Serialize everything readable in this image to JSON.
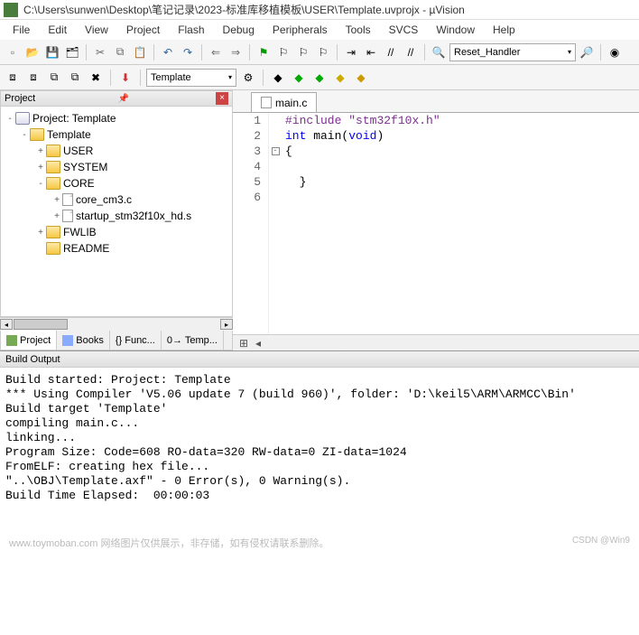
{
  "title": "C:\\Users\\sunwen\\Desktop\\笔记记录\\2023-标准库移植模板\\USER\\Template.uvprojx - µVision",
  "menu": [
    "File",
    "Edit",
    "View",
    "Project",
    "Flash",
    "Debug",
    "Peripherals",
    "Tools",
    "SVCS",
    "Window",
    "Help"
  ],
  "toolbar": {
    "go_combo": "Reset_Handler",
    "target_combo": "Template"
  },
  "project_panel": {
    "title": "Project",
    "tree": {
      "root": "Project: Template",
      "target": "Template",
      "groups": [
        {
          "name": "USER",
          "open": false
        },
        {
          "name": "SYSTEM",
          "open": false
        },
        {
          "name": "CORE",
          "open": true,
          "files": [
            "core_cm3.c",
            "startup_stm32f10x_hd.s"
          ]
        },
        {
          "name": "FWLIB",
          "open": false
        },
        {
          "name": "README",
          "open": false,
          "leaf": true
        }
      ]
    },
    "tabs": [
      "Project",
      "Books",
      "{} Func...",
      "0→ Temp..."
    ]
  },
  "editor": {
    "tab": "main.c",
    "lines": [
      {
        "n": 1,
        "pp": "#include",
        "str": "\"stm32f10x.h\""
      },
      {
        "n": 2,
        "kw": "int",
        "txt": " main(",
        "kw2": "void",
        "txt2": ")"
      },
      {
        "n": 3,
        "fold": "-",
        "txt": "{"
      },
      {
        "n": 4,
        "txt": ""
      },
      {
        "n": 5,
        "txt": "  }"
      },
      {
        "n": 6,
        "txt": ""
      }
    ]
  },
  "build": {
    "title": "Build Output",
    "lines": [
      "Build started: Project: Template",
      "*** Using Compiler 'V5.06 update 7 (build 960)', folder: 'D:\\keil5\\ARM\\ARMCC\\Bin'",
      "Build target 'Template'",
      "compiling main.c...",
      "linking...",
      "Program Size: Code=608 RO-data=320 RW-data=0 ZI-data=1024",
      "FromELF: creating hex file...",
      "\"..\\OBJ\\Template.axf\" - 0 Error(s), 0 Warning(s).",
      "Build Time Elapsed:  00:00:03"
    ]
  },
  "footer": {
    "left": "www.toymoban.com 网络图片仅供展示，非存储，如有侵权请联系删除。",
    "right": "CSDN @Win9"
  }
}
